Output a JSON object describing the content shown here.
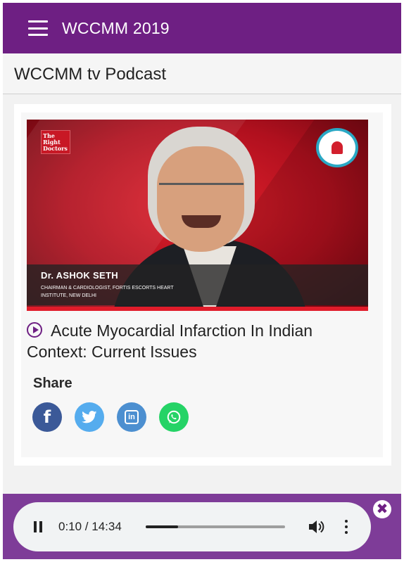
{
  "app": {
    "title": "WCCMM 2019",
    "header_color": "#6e1f83"
  },
  "page": {
    "title": "WCCMM tv Podcast"
  },
  "episode": {
    "title": "Acute Myocardial Infarction In Indian Context: Current Issues",
    "thumbnail": {
      "logo_text": "The Right Doctors",
      "speaker_name": "Dr. ASHOK SETH",
      "speaker_role": "CHAIRMAN & CARDIOLOGIST, FORTIS ESCORTS HEART INSTITUTE, NEW DELHI"
    }
  },
  "share": {
    "label": "Share",
    "buttons": [
      {
        "name": "facebook",
        "icon": "facebook-icon",
        "color": "#3b5998",
        "glyph": "f"
      },
      {
        "name": "twitter",
        "icon": "twitter-icon",
        "color": "#55acee"
      },
      {
        "name": "linkedin",
        "icon": "linkedin-icon",
        "color": "#4c8fd0",
        "glyph": "in"
      },
      {
        "name": "whatsapp",
        "icon": "whatsapp-icon",
        "color": "#25d366"
      }
    ]
  },
  "player": {
    "time_display": "0:10 / 14:34",
    "progress_fraction": 0.23,
    "area_color": "#7e3c98",
    "close_glyph": "✖"
  }
}
